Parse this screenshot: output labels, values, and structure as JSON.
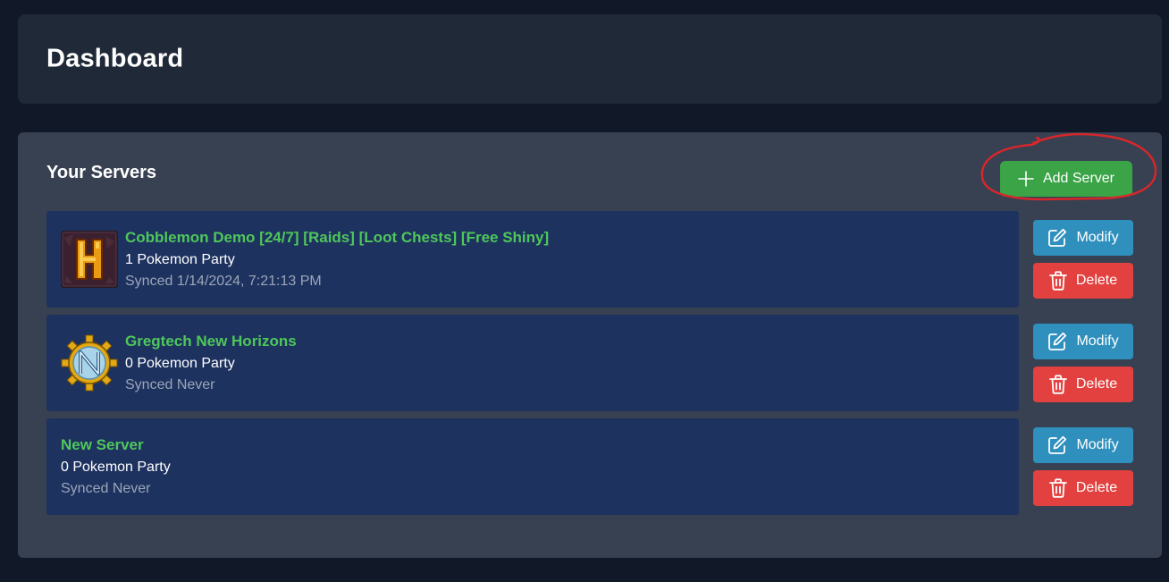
{
  "header": {
    "title": "Dashboard"
  },
  "servers_section": {
    "title": "Your Servers",
    "add_button_label": "Add Server"
  },
  "actions": {
    "modify_label": "Modify",
    "delete_label": "Delete"
  },
  "servers": [
    {
      "name": "Cobblemon Demo [24/7] [Raids] [Loot Chests] [Free Shiny]",
      "party": "1 Pokemon Party",
      "synced": "Synced 1/14/2024, 7:21:13 PM",
      "icon": "hypixel-h-logo-icon"
    },
    {
      "name": "Gregtech New Horizons",
      "party": "0 Pokemon Party",
      "synced": "Synced Never",
      "icon": "gtnh-gear-logo-icon"
    },
    {
      "name": "New Server",
      "party": "0 Pokemon Party",
      "synced": "Synced Never",
      "icon": ""
    }
  ],
  "colors": {
    "background": "#111827",
    "header_card": "#1f2937",
    "servers_card": "#374151",
    "server_row": "#1e3260",
    "server_name": "#4ec75a",
    "add_button": "#3aa447",
    "modify_button": "#2f8fbd",
    "delete_button": "#e2413f",
    "annotation_circle": "#d9262a"
  }
}
